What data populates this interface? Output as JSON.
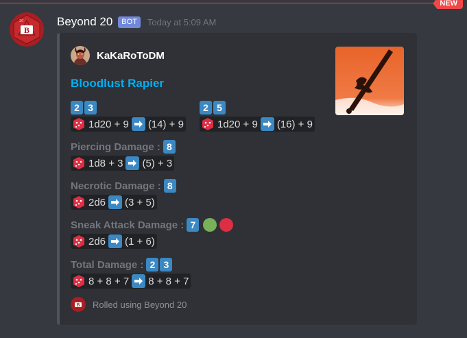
{
  "header": {
    "new_label": "NEW"
  },
  "message": {
    "author": "Beyond 20",
    "bot_tag": "BOT",
    "timestamp": "Today at 5:09 AM",
    "avatar_icon": "beyond20-d20-icon"
  },
  "embed": {
    "author_name": "KaKaRoToDM",
    "author_icon": "tiefling-portrait-avatar",
    "title": "Bloodlust Rapier",
    "thumbnail": "rapier-sword-thumbnail",
    "to_hit": [
      {
        "digits": [
          "2",
          "3"
        ],
        "dice": "1d20 + 9",
        "result": "(14) + 9"
      },
      {
        "digits": [
          "2",
          "5"
        ],
        "dice": "1d20 + 9",
        "result": "(16) + 9"
      }
    ],
    "fields": [
      {
        "name": "Piercing Damage :",
        "digits": [
          "8"
        ],
        "dice": "1d8 + 3",
        "result": "(5) + 3"
      },
      {
        "name": "Necrotic Damage :",
        "digits": [
          "8"
        ],
        "dice": "2d6",
        "result": "(3 + 5)"
      },
      {
        "name": "Sneak Attack Damage :",
        "digits": [
          "7"
        ],
        "circles": [
          "green",
          "red"
        ],
        "dice": "2d6",
        "result": "(1 + 6)"
      },
      {
        "name": "Total Damage :",
        "digits": [
          "2",
          "3"
        ],
        "dice": "8 + 8 + 7",
        "result": "8 + 8 + 7"
      }
    ],
    "footer": "Rolled using Beyond 20"
  },
  "colors": {
    "accent_blue": "#00b0f4",
    "digit_blue": "#3b88c3",
    "new_red": "#f04747",
    "green_circle": "#78b159",
    "red_circle": "#dd2e44"
  }
}
